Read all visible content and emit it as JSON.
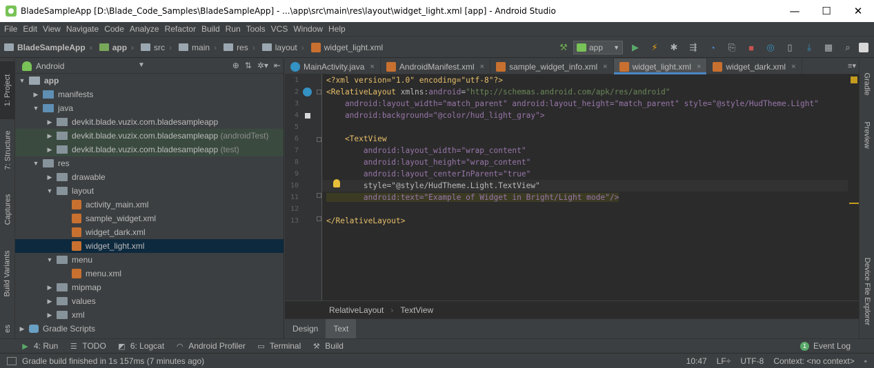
{
  "window": {
    "title": "BladeSampleApp [D:\\Blade_Code_Samples\\BladeSampleApp] - ...\\app\\src\\main\\res\\layout\\widget_light.xml [app] - Android Studio",
    "minimize": "—",
    "maximize": "☐",
    "close": "✕"
  },
  "menu": [
    "File",
    "Edit",
    "View",
    "Navigate",
    "Code",
    "Analyze",
    "Refactor",
    "Build",
    "Run",
    "Tools",
    "VCS",
    "Window",
    "Help"
  ],
  "navbar": {
    "crumbs": [
      "BladeSampleApp",
      "app",
      "src",
      "main",
      "res",
      "layout",
      "widget_light.xml"
    ],
    "run_config": "app"
  },
  "left_tabs": [
    "1: Project",
    "7: Structure",
    "Captures",
    "Build Variants",
    "es"
  ],
  "right_tabs": [
    "Gradle",
    "Preview",
    "Device File Explorer"
  ],
  "project_panel": {
    "view": "Android",
    "tree": [
      {
        "label": "app",
        "indent": 0,
        "arrow": "▼",
        "icon": "app",
        "bold": true
      },
      {
        "label": "manifests",
        "indent": 1,
        "arrow": "▶",
        "icon": "blue"
      },
      {
        "label": "java",
        "indent": 1,
        "arrow": "▼",
        "icon": "blue"
      },
      {
        "label": "devkit.blade.vuzix.com.bladesampleapp",
        "suffix": "",
        "indent": 2,
        "arrow": "▶",
        "icon": "pkg"
      },
      {
        "label": "devkit.blade.vuzix.com.bladesampleapp",
        "suffix": " (androidTest)",
        "indent": 2,
        "arrow": "▶",
        "icon": "pkg",
        "hl": true
      },
      {
        "label": "devkit.blade.vuzix.com.bladesampleapp",
        "suffix": " (test)",
        "indent": 2,
        "arrow": "▶",
        "icon": "pkg",
        "hl": true
      },
      {
        "label": "res",
        "indent": 1,
        "arrow": "▼",
        "icon": "res"
      },
      {
        "label": "drawable",
        "indent": 2,
        "arrow": "▶",
        "icon": "folder"
      },
      {
        "label": "layout",
        "indent": 2,
        "arrow": "▼",
        "icon": "folder"
      },
      {
        "label": "activity_main.xml",
        "indent": 3,
        "arrow": "",
        "icon": "xml"
      },
      {
        "label": "sample_widget.xml",
        "indent": 3,
        "arrow": "",
        "icon": "xml"
      },
      {
        "label": "widget_dark.xml",
        "indent": 3,
        "arrow": "",
        "icon": "xml"
      },
      {
        "label": "widget_light.xml",
        "indent": 3,
        "arrow": "",
        "icon": "xml",
        "selected": true
      },
      {
        "label": "menu",
        "indent": 2,
        "arrow": "▼",
        "icon": "folder"
      },
      {
        "label": "menu.xml",
        "indent": 3,
        "arrow": "",
        "icon": "xml"
      },
      {
        "label": "mipmap",
        "indent": 2,
        "arrow": "▶",
        "icon": "folder"
      },
      {
        "label": "values",
        "indent": 2,
        "arrow": "▶",
        "icon": "folder"
      },
      {
        "label": "xml",
        "indent": 2,
        "arrow": "▶",
        "icon": "folder"
      },
      {
        "label": "Gradle Scripts",
        "indent": 0,
        "arrow": "▶",
        "icon": "gradle"
      }
    ]
  },
  "tabs": [
    {
      "label": "MainActivity.java",
      "icon": "#3592c4",
      "active": false
    },
    {
      "label": "AndroidManifest.xml",
      "icon": "#c8702f",
      "active": false
    },
    {
      "label": "sample_widget_info.xml",
      "icon": "#c8702f",
      "active": false
    },
    {
      "label": "widget_light.xml",
      "icon": "#c8702f",
      "active": true
    },
    {
      "label": "widget_dark.xml",
      "icon": "#c8702f",
      "active": false
    }
  ],
  "code_lines": [
    "1",
    "2",
    "3",
    "4",
    "5",
    "6",
    "7",
    "8",
    "9",
    "10",
    "11",
    "12",
    "13"
  ],
  "code": {
    "l1": "<?xml version=\"1.0\" encoding=\"utf-8\"?>",
    "l2_tag": "<RelativeLayout",
    "l2_ns": " xmlns:",
    "l2_attr": "android",
    "l2_eq": "=",
    "l2_val": "\"http://schemas.android.com/apk/res/android\"",
    "l3": "    android:layout_width=\"match_parent\" android:layout_height=\"match_parent\" style=\"@style/HudTheme.Light\"",
    "l4": "    android:background=\"@color/hud_light_gray\">",
    "l6": "    <TextView",
    "l7": "        android:layout_width=\"wrap_content\"",
    "l8": "        android:layout_height=\"wrap_content\"",
    "l9": "        android:layout_centerInParent=\"true\"",
    "l10": "        style=\"@style/HudTheme.Light.TextView\"",
    "l11": "        android:text=\"Example of Widget in Bright/Light mode\"/>",
    "l13": "</RelativeLayout>"
  },
  "breadcrumbs": [
    "RelativeLayout",
    "TextView"
  ],
  "design_tabs": [
    "Design",
    "Text"
  ],
  "bottom_tools": [
    {
      "label": "4: Run",
      "icon": "▶"
    },
    {
      "label": "TODO",
      "icon": "☰"
    },
    {
      "label": "6: Logcat",
      "icon": "◩"
    },
    {
      "label": "Android Profiler",
      "icon": "◠"
    },
    {
      "label": "Terminal",
      "icon": "▭"
    },
    {
      "label": "Build",
      "icon": "⚒"
    }
  ],
  "event_log": {
    "label": "Event Log",
    "badge": "1"
  },
  "status": {
    "message": "Gradle build finished in 1s 157ms (7 minutes ago)",
    "position": "10:47",
    "line_sep": "LF÷",
    "encoding": "UTF-8",
    "context": "Context: <no context>"
  },
  "colors": {
    "tag": "#e8bf6a",
    "attr": "#bababa",
    "ns": "#9876aa",
    "string": "#6a8759",
    "selection": "#0d293e",
    "active_tab_underline": "#4a88c7"
  }
}
